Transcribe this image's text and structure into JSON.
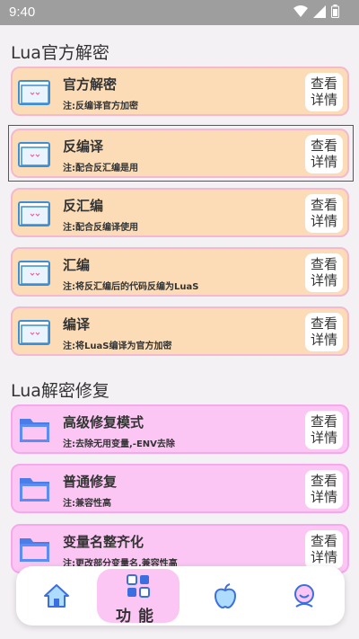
{
  "status_bar": {
    "time": "9:40"
  },
  "sections": [
    {
      "title": "Lua官方解密",
      "items": [
        {
          "title": "官方解密",
          "subtitle": "注:反编译官方加密",
          "button": [
            "查看",
            "详情"
          ]
        },
        {
          "title": "反编译",
          "subtitle": "注:配合反汇编是用",
          "button": [
            "查看",
            "详情"
          ]
        },
        {
          "title": "反汇编",
          "subtitle": "注:配合反编译使用",
          "button": [
            "查看",
            "详情"
          ]
        },
        {
          "title": "汇编",
          "subtitle": "注:将反汇编后的代码反编为LuaS",
          "button": [
            "查看",
            "详情"
          ]
        },
        {
          "title": "编译",
          "subtitle": "注:将LuaS编译为官方加密",
          "button": [
            "查看",
            "详情"
          ]
        }
      ]
    },
    {
      "title": "Lua解密修复",
      "items": [
        {
          "title": "高级修复模式",
          "subtitle": "注:去除无用变量,-ENV去除",
          "button": [
            "查看",
            "详情"
          ]
        },
        {
          "title": "普通修复",
          "subtitle": "注:兼容性高",
          "button": [
            "查看",
            "详情"
          ]
        },
        {
          "title": "变量名整齐化",
          "subtitle": "注:更改部分变量名,兼容性高",
          "button": [
            "查看",
            "详情"
          ]
        }
      ]
    }
  ],
  "bottom_nav": {
    "active_label": "功能",
    "items": [
      "home-icon",
      "grid-icon",
      "apple-icon",
      "user-icon"
    ]
  },
  "colors": {
    "card_orange": "#fcdcb6",
    "card_pink": "#fbc6f4",
    "nav_active": "#fbc6f4",
    "accent_blue": "#4a7de8"
  }
}
